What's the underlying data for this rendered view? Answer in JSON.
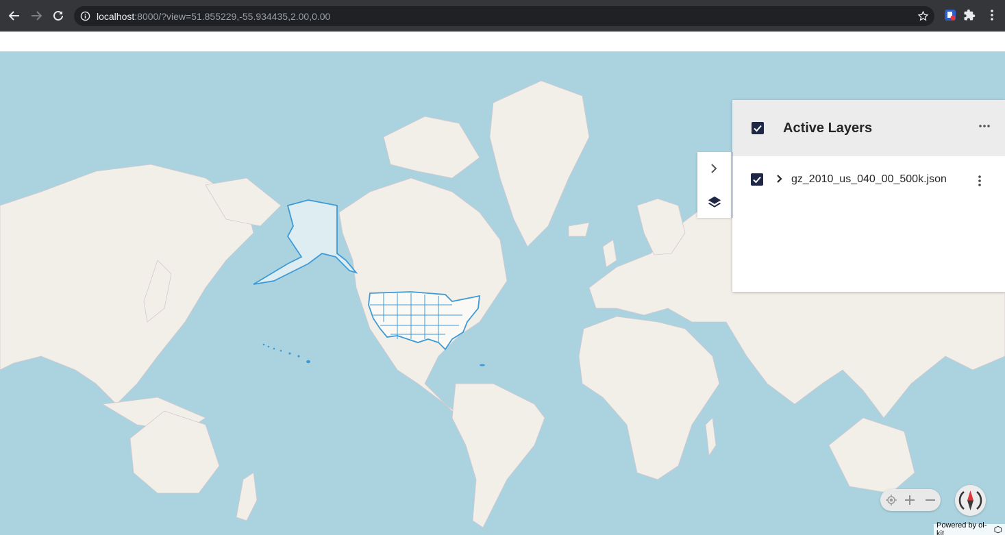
{
  "browser": {
    "url_host": "localhost",
    "url_rest": ":8000/?view=51.855229,-55.934435,2.00,0.00"
  },
  "layer_panel": {
    "title": "Active Layers",
    "all_checked": true,
    "layers": [
      {
        "name": "gz_2010_us_040_00_500k.json",
        "checked": true
      }
    ]
  },
  "attribution": {
    "text": "Powered by ol-kit"
  },
  "colors": {
    "water": "#aad3df",
    "land": "#f2efe9",
    "feature_stroke": "#3d9ad6",
    "panel_accent": "#1e2746"
  },
  "icons": [
    "back-icon",
    "forward-icon",
    "reload-icon",
    "info-icon",
    "star-icon",
    "extension-icon",
    "puzzle-icon",
    "kebab-icon",
    "chevron-right-icon",
    "layers-icon",
    "ellipsis-icon",
    "locate-icon",
    "plus-icon",
    "minus-icon",
    "compass-icon"
  ]
}
